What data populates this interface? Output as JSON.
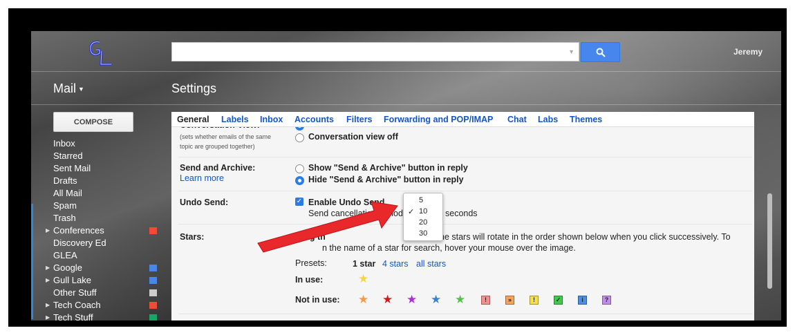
{
  "header": {
    "user_name": "Jeremy"
  },
  "sidebar": {
    "mail_label": "Mail",
    "compose_label": "COMPOSE",
    "items": [
      {
        "label": "Inbox",
        "expandable": false,
        "color": null
      },
      {
        "label": "Starred",
        "expandable": false,
        "color": null
      },
      {
        "label": "Sent Mail",
        "expandable": false,
        "color": null
      },
      {
        "label": "Drafts",
        "expandable": false,
        "color": null
      },
      {
        "label": "All Mail",
        "expandable": false,
        "color": null
      },
      {
        "label": "Spam",
        "expandable": false,
        "color": null
      },
      {
        "label": "Trash",
        "expandable": false,
        "color": null
      },
      {
        "label": "Conferences",
        "expandable": true,
        "color": "#f04b37"
      },
      {
        "label": "Discovery Ed",
        "expandable": false,
        "color": null
      },
      {
        "label": "GLEA",
        "expandable": false,
        "color": null
      },
      {
        "label": "Google",
        "expandable": true,
        "color": "#4a86e8"
      },
      {
        "label": "Gull Lake",
        "expandable": true,
        "color": "#4a86e8"
      },
      {
        "label": "Other Stuff",
        "expandable": false,
        "color": "#cccccc"
      },
      {
        "label": "Tech Coach",
        "expandable": true,
        "color": "#f04b37"
      },
      {
        "label": "Tech Stuff",
        "expandable": true,
        "color": "#16a765"
      }
    ]
  },
  "settings": {
    "title": "Settings",
    "tabs": [
      "General",
      "Labels",
      "Inbox",
      "Accounts",
      "Filters",
      "Forwarding and POP/IMAP",
      "Chat",
      "Labs",
      "Themes"
    ],
    "active_tab": "General",
    "conversation_view": {
      "label_partial": "Conversation View:",
      "desc_line1": "(sets whether emails of the same",
      "desc_line2": "topic are grouped together)",
      "option_on_partial": "Conversation view on",
      "option_off": "Conversation view off"
    },
    "send_archive": {
      "label": "Send and Archive:",
      "learn_more": "Learn more",
      "option_show": "Show \"Send & Archive\" button in reply",
      "option_hide": "Hide \"Send & Archive\" button in reply"
    },
    "undo_send": {
      "label": "Undo Send:",
      "enable_label": "Enable Undo Send",
      "cancel_prefix": "Send cancellation period",
      "cancel_suffix": "seconds",
      "options": [
        "5",
        "10",
        "20",
        "30"
      ],
      "selected": "10"
    },
    "stars": {
      "label": "Stars:",
      "desc_line1_start": "Drag th",
      "desc_line1_end": "he stars will rotate in the order shown below when you click successively. To",
      "desc_line2_visible": "n the name of a star for search, hover your mouse over the image.",
      "presets_label": "Presets:",
      "presets": [
        "1 star",
        "4 stars",
        "all stars"
      ],
      "in_use_label": "In use:",
      "not_in_use_label": "Not in use:",
      "in_use_colors": [
        "#f7d443"
      ],
      "not_in_use_stars": [
        "#f39a4b",
        "#d61818",
        "#a932d6",
        "#3a80d5",
        "#56c149"
      ],
      "not_in_use_squares": [
        {
          "symbol": "!",
          "color": "#f58f8f"
        },
        {
          "symbol": "»",
          "color": "#f7a35c"
        },
        {
          "symbol": "!",
          "color": "#f6e04a"
        },
        {
          "symbol": "✓",
          "color": "#40c94a"
        },
        {
          "symbol": "i",
          "color": "#4a90e2"
        },
        {
          "symbol": "?",
          "color": "#c08ee8"
        }
      ]
    }
  },
  "colors": {
    "accent": "#4787ed",
    "link": "#1155cc",
    "arrow": "#e8282b"
  }
}
